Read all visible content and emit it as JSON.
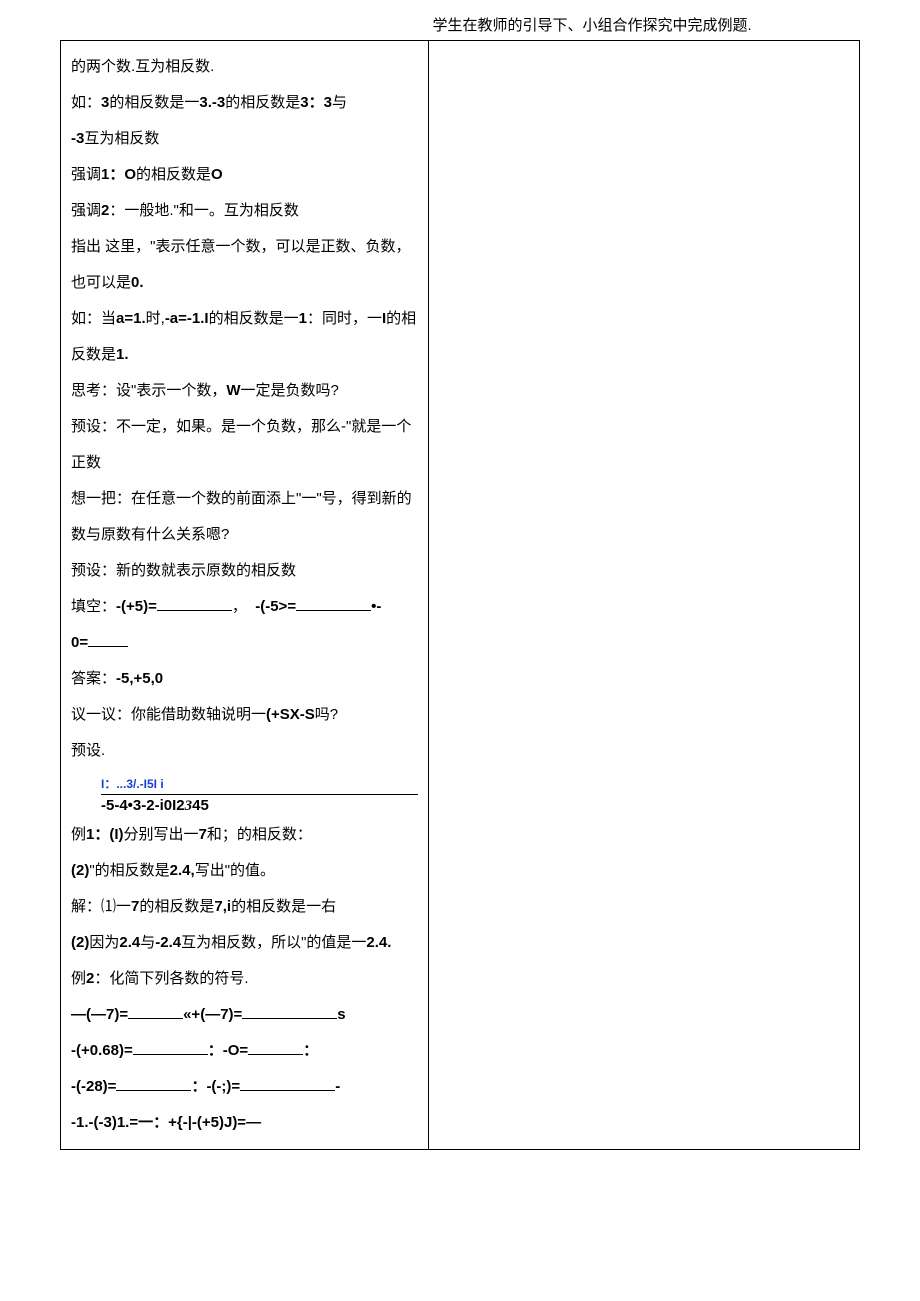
{
  "left": {
    "p1": "的两个数.互为相反数.",
    "p2_a": "如：",
    "p2_b": "3",
    "p2_c": "的相反数是一",
    "p2_d": "3.-3",
    "p2_e": "的相反数是",
    "p2_f": "3：3",
    "p2_g": "与",
    "p3_a": "-3",
    "p3_b": "互为相反数",
    "p4_a": "强调",
    "p4_b": "1：O",
    "p4_c": "的相反数是",
    "p4_d": "O",
    "p5_a": "强调",
    "p5_b": "2",
    "p5_c": "：一般地.\"和一。互为相反数",
    "p6": "指出 这里，\"表示任意一个数，可以是正数、负数，也可以是",
    "p6_b": "0.",
    "p7_a": "如：当",
    "p7_b": "a=1.",
    "p7_c": "时,",
    "p7_d": "-a=-1.I",
    "p7_e": "的相反数是一",
    "p7_f": "1",
    "p7_g": "：同时，一",
    "p7_h": "I",
    "p7_i": "的相反数是",
    "p7_j": "1.",
    "p8_a": "思考：设\"表示一个数，",
    "p8_b": "W",
    "p8_c": "一定是负数吗?",
    "p9": "预设：不一定，如果。是一个负数，那么-\"就是一个正数",
    "p10": "想一把：在任意一个数的前面添上\"一\"号，得到新的数与原数有什么关系嗯?",
    "p11": "预设：新的数就表示原数的相反数",
    "p12_a": "填空：",
    "p12_b": "-(+5)=",
    "p12_c": "，",
    "p12_d": "-(-5>=",
    "p12_e": "•-",
    "p13_a": "0=",
    "p14_a": "答案：",
    "p14_b": "-5,+5,0",
    "p15_a": "议一议：你能借助数轴说明一",
    "p15_b": "(+SX-S",
    "p15_c": "吗?",
    "p16": "预设.",
    "numline_label": "I：...3/.-I5I i",
    "numline_ticks_a": "-5-4•3-2-i0I2",
    "numline_ticks_b": "3",
    "numline_ticks_c": "45",
    "p17_a": "例",
    "p17_b": "1：(I)",
    "p17_c": "分别写出一",
    "p17_d": "7",
    "p17_e": "和；的相反数：",
    "p18_a": "(2)",
    "p18_b": "\"的相反数是",
    "p18_c": "2.4,",
    "p18_d": "写出\"的值。",
    "p19_a": "解：⑴一",
    "p19_b": "7",
    "p19_c": "的相反数是",
    "p19_d": "7,i",
    "p19_e": "的相反数是一右",
    "p20_a": "(2)",
    "p20_b": "因为",
    "p20_c": "2.4",
    "p20_d": "与",
    "p20_e": "-2.4",
    "p20_f": "互为相反数，所以\"的值是一",
    "p20_g": "2.4.",
    "p21_a": "例",
    "p21_b": "2",
    "p21_c": "：化简下列各数的符号.",
    "p22_a": "—(—7)=",
    "p22_b": "«+(—7)=",
    "p22_c": "s",
    "p23_a": "-(+0.68)=",
    "p23_b": "：-O=",
    "p23_c": "：",
    "p24_a": "-(-28)=",
    "p24_b": "：-(-;)=",
    "p24_c": "-",
    "p25_a": "-1.-(-3)1.=一：+{-|-(+5)J)=—"
  },
  "right": {
    "bottom": "学生在教师的引导下、小组合作探究中完成例题."
  }
}
